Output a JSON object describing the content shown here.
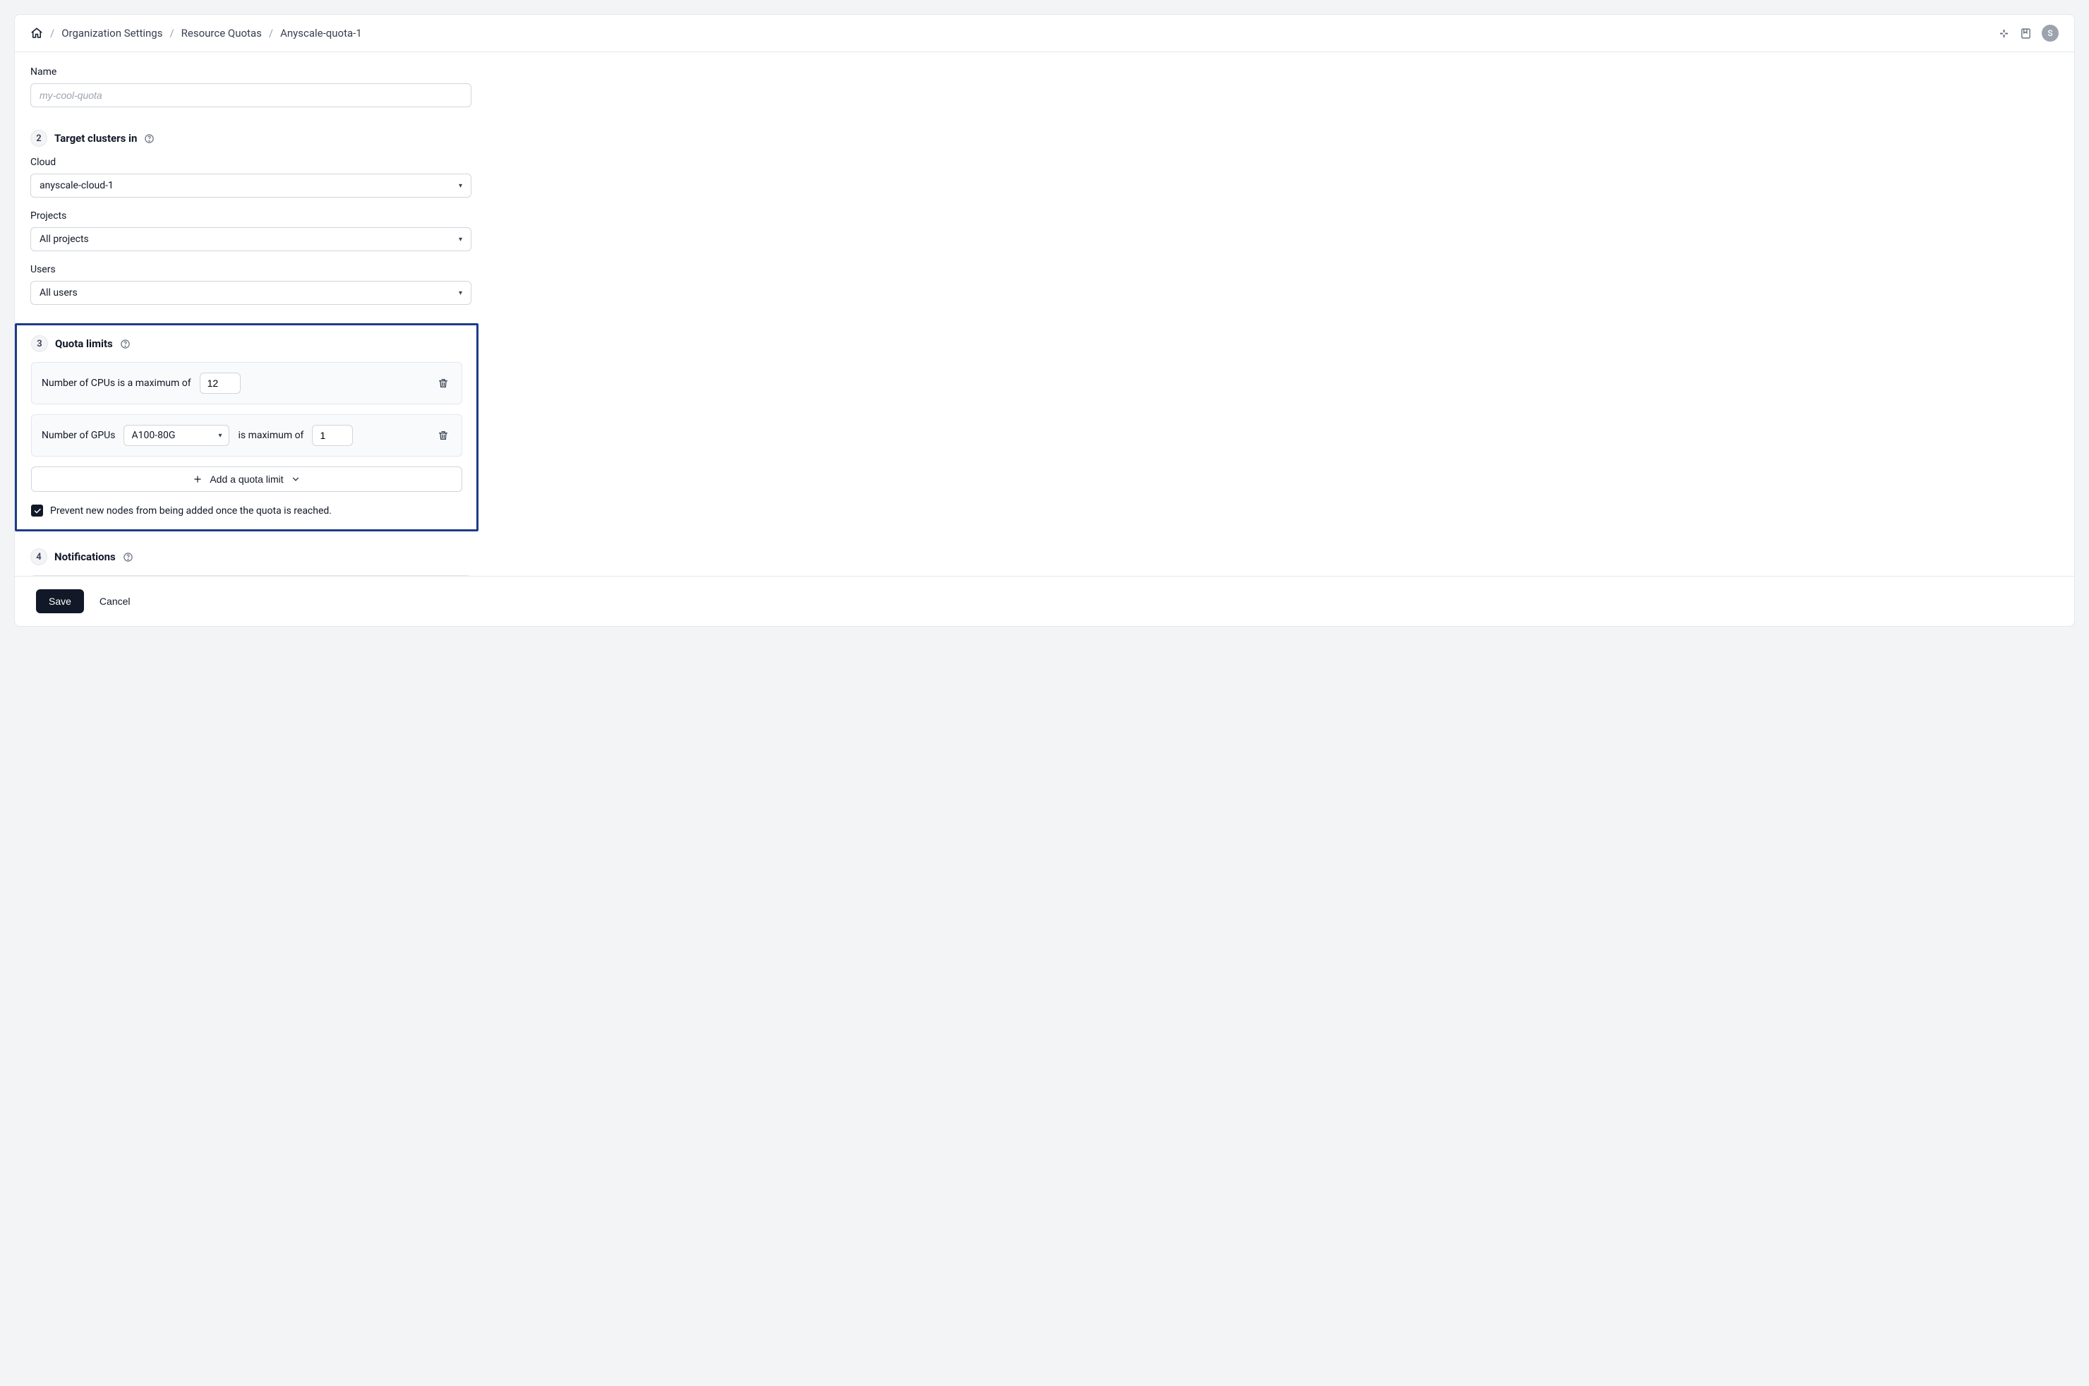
{
  "breadcrumbs": {
    "items": [
      "Organization Settings",
      "Resource Quotas",
      "Anyscale-quota-1"
    ]
  },
  "header": {
    "avatar_initial": "S"
  },
  "form": {
    "name_label": "Name",
    "name_placeholder": "my-cool-quota",
    "sections": {
      "target": {
        "step": "2",
        "title": "Target clusters in",
        "cloud_label": "Cloud",
        "cloud_value": "anyscale-cloud-1",
        "projects_label": "Projects",
        "projects_value": "All projects",
        "users_label": "Users",
        "users_value": "All users"
      },
      "quota": {
        "step": "3",
        "title": "Quota limits",
        "rows": {
          "cpu": {
            "text": "Number of CPUs is a maximum of",
            "value": "12"
          },
          "gpu": {
            "text_before": "Number of GPUs",
            "gpu_type": "A100-80G",
            "text_after": "is maximum of",
            "value": "1"
          }
        },
        "add_label": "Add a quota limit",
        "prevent_label": "Prevent new nodes from being added once the quota is reached."
      },
      "notifications": {
        "step": "4",
        "title": "Notifications"
      }
    }
  },
  "footer": {
    "save": "Save",
    "cancel": "Cancel"
  }
}
